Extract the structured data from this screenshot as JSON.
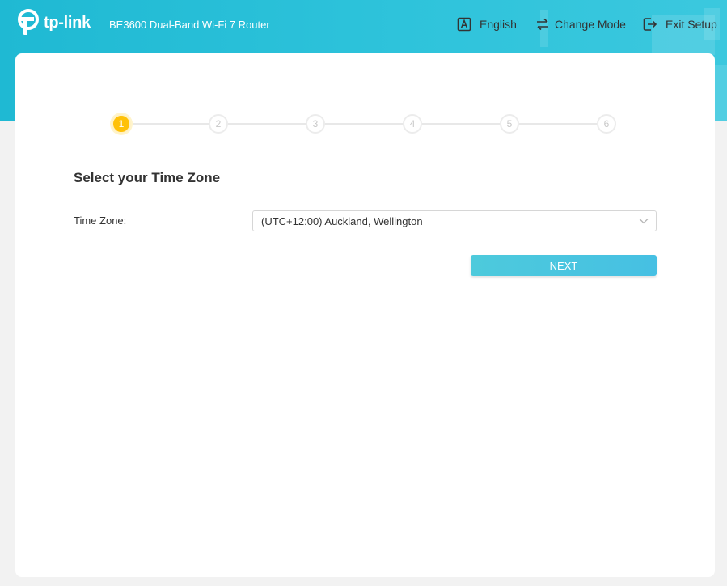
{
  "header": {
    "brand": "tp-link",
    "model": "BE3600 Dual-Band Wi-Fi 7 Router",
    "language_label": "English",
    "change_mode_label": "Change Mode",
    "exit_setup_label": "Exit Setup"
  },
  "steps": [
    "1",
    "2",
    "3",
    "4",
    "5",
    "6"
  ],
  "current_step": 1,
  "section": {
    "title": "Select your Time Zone"
  },
  "timezone": {
    "label": "Time Zone:",
    "selected": "(UTC+12:00) Auckland, Wellington"
  },
  "buttons": {
    "next": "NEXT"
  },
  "colors": {
    "banner": "#2ec3db",
    "active_step": "#ffc107",
    "next_button": "#4dcadc"
  }
}
